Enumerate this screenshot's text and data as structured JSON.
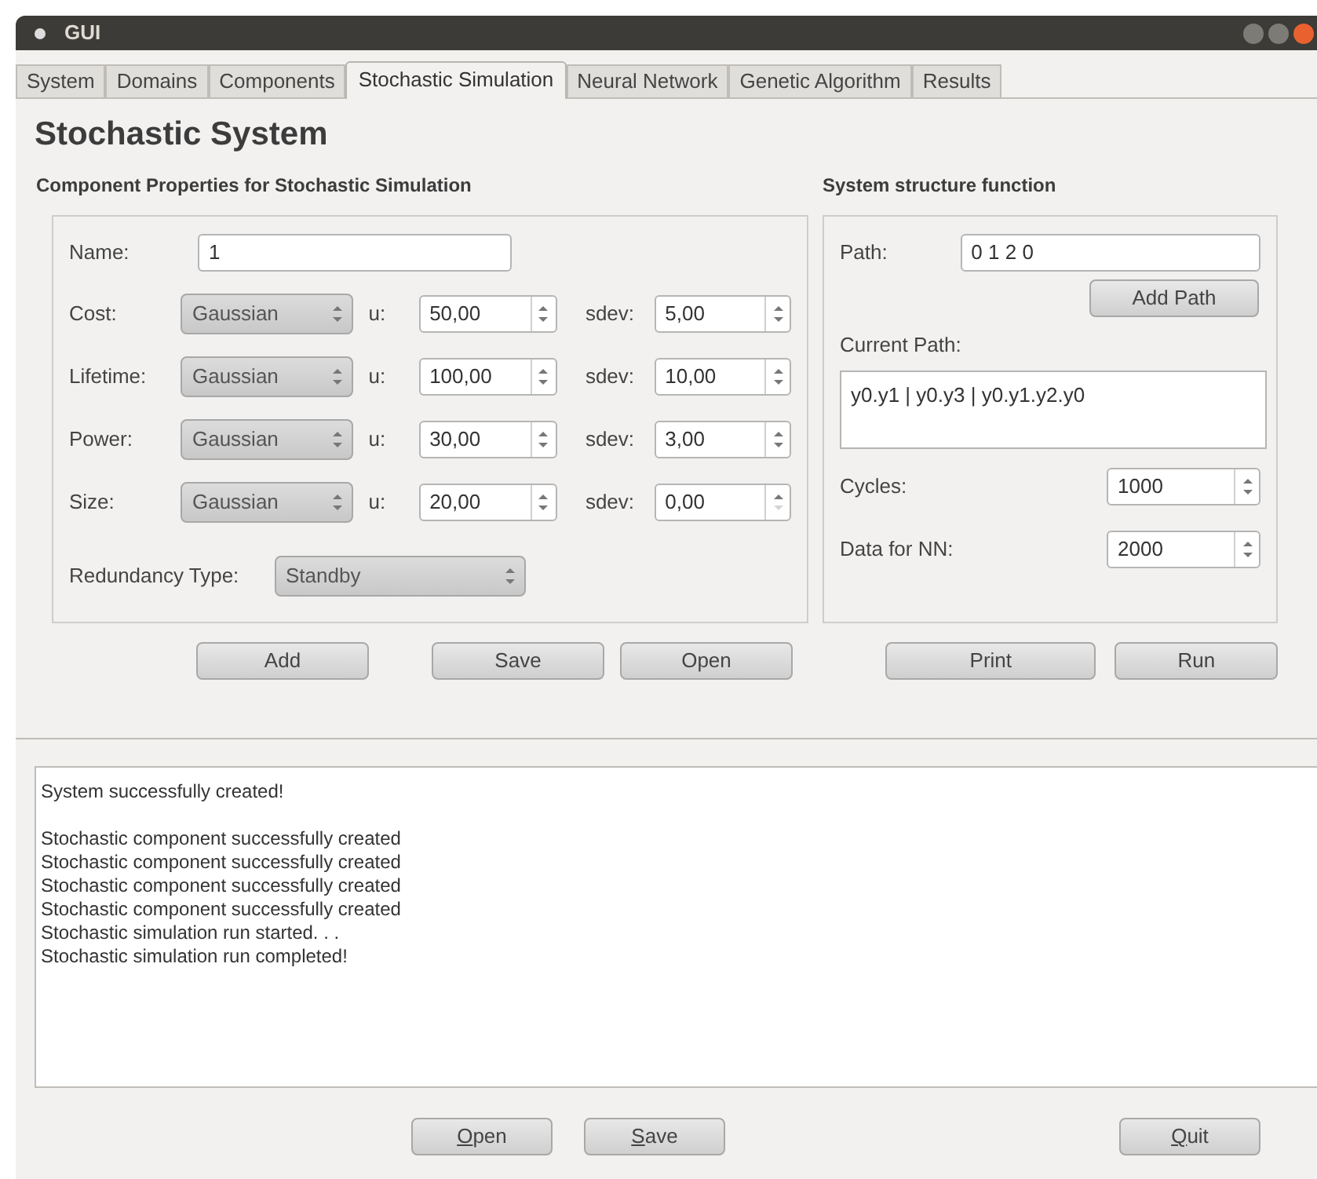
{
  "window": {
    "title": "GUI"
  },
  "tabs": [
    {
      "label": "System",
      "selected": false
    },
    {
      "label": "Domains",
      "selected": false
    },
    {
      "label": "Components",
      "selected": false
    },
    {
      "label": "Stochastic Simulation",
      "selected": true
    },
    {
      "label": "Neural Network",
      "selected": false
    },
    {
      "label": "Genetic Algorithm",
      "selected": false
    },
    {
      "label": "Results",
      "selected": false
    }
  ],
  "heading": "Stochastic System",
  "component_panel": {
    "title": "Component Properties for Stochastic Simulation",
    "name_label": "Name:",
    "name_value": "1",
    "rows": [
      {
        "label": "Cost:",
        "distribution": "Gaussian",
        "u_label": "u:",
        "u": "50,00",
        "sdev_label": "sdev:",
        "sdev": "5,00",
        "sdev_down_enabled": true
      },
      {
        "label": "Lifetime:",
        "distribution": "Gaussian",
        "u_label": "u:",
        "u": "100,00",
        "sdev_label": "sdev:",
        "sdev": "10,00",
        "sdev_down_enabled": true
      },
      {
        "label": "Power:",
        "distribution": "Gaussian",
        "u_label": "u:",
        "u": "30,00",
        "sdev_label": "sdev:",
        "sdev": "3,00",
        "sdev_down_enabled": true
      },
      {
        "label": "Size:",
        "distribution": "Gaussian",
        "u_label": "u:",
        "u": "20,00",
        "sdev_label": "sdev:",
        "sdev": "0,00",
        "sdev_down_enabled": false
      }
    ],
    "redundancy_label": "Redundancy Type:",
    "redundancy_value": "Standby",
    "buttons": [
      "Add",
      "Save",
      "Open"
    ]
  },
  "structure_panel": {
    "title": "System structure function",
    "path_label": "Path:",
    "path_value": "0 1 2 0",
    "add_path_button": "Add Path",
    "current_path_label": "Current Path:",
    "current_path": "y0.y1 | y0.y3 | y0.y1.y2.y0",
    "cycles_label": "Cycles:",
    "cycles": "1000",
    "data_label": "Data for NN:",
    "data": "2000",
    "buttons": [
      "Print",
      "Run"
    ]
  },
  "log": [
    {
      "lines": [
        "System successfully created!"
      ]
    },
    {
      "lines": [
        "Stochastic component successfully created",
        "Stochastic component successfully created",
        "Stochastic component successfully created",
        "Stochastic component successfully created",
        "Stochastic simulation run started. . .",
        "Stochastic simulation run completed!"
      ]
    }
  ],
  "bottom_buttons": [
    {
      "label": "Open",
      "mnemonic": true
    },
    {
      "label": "Save",
      "mnemonic": true
    },
    {
      "label": "Quit",
      "mnemonic": true
    }
  ]
}
